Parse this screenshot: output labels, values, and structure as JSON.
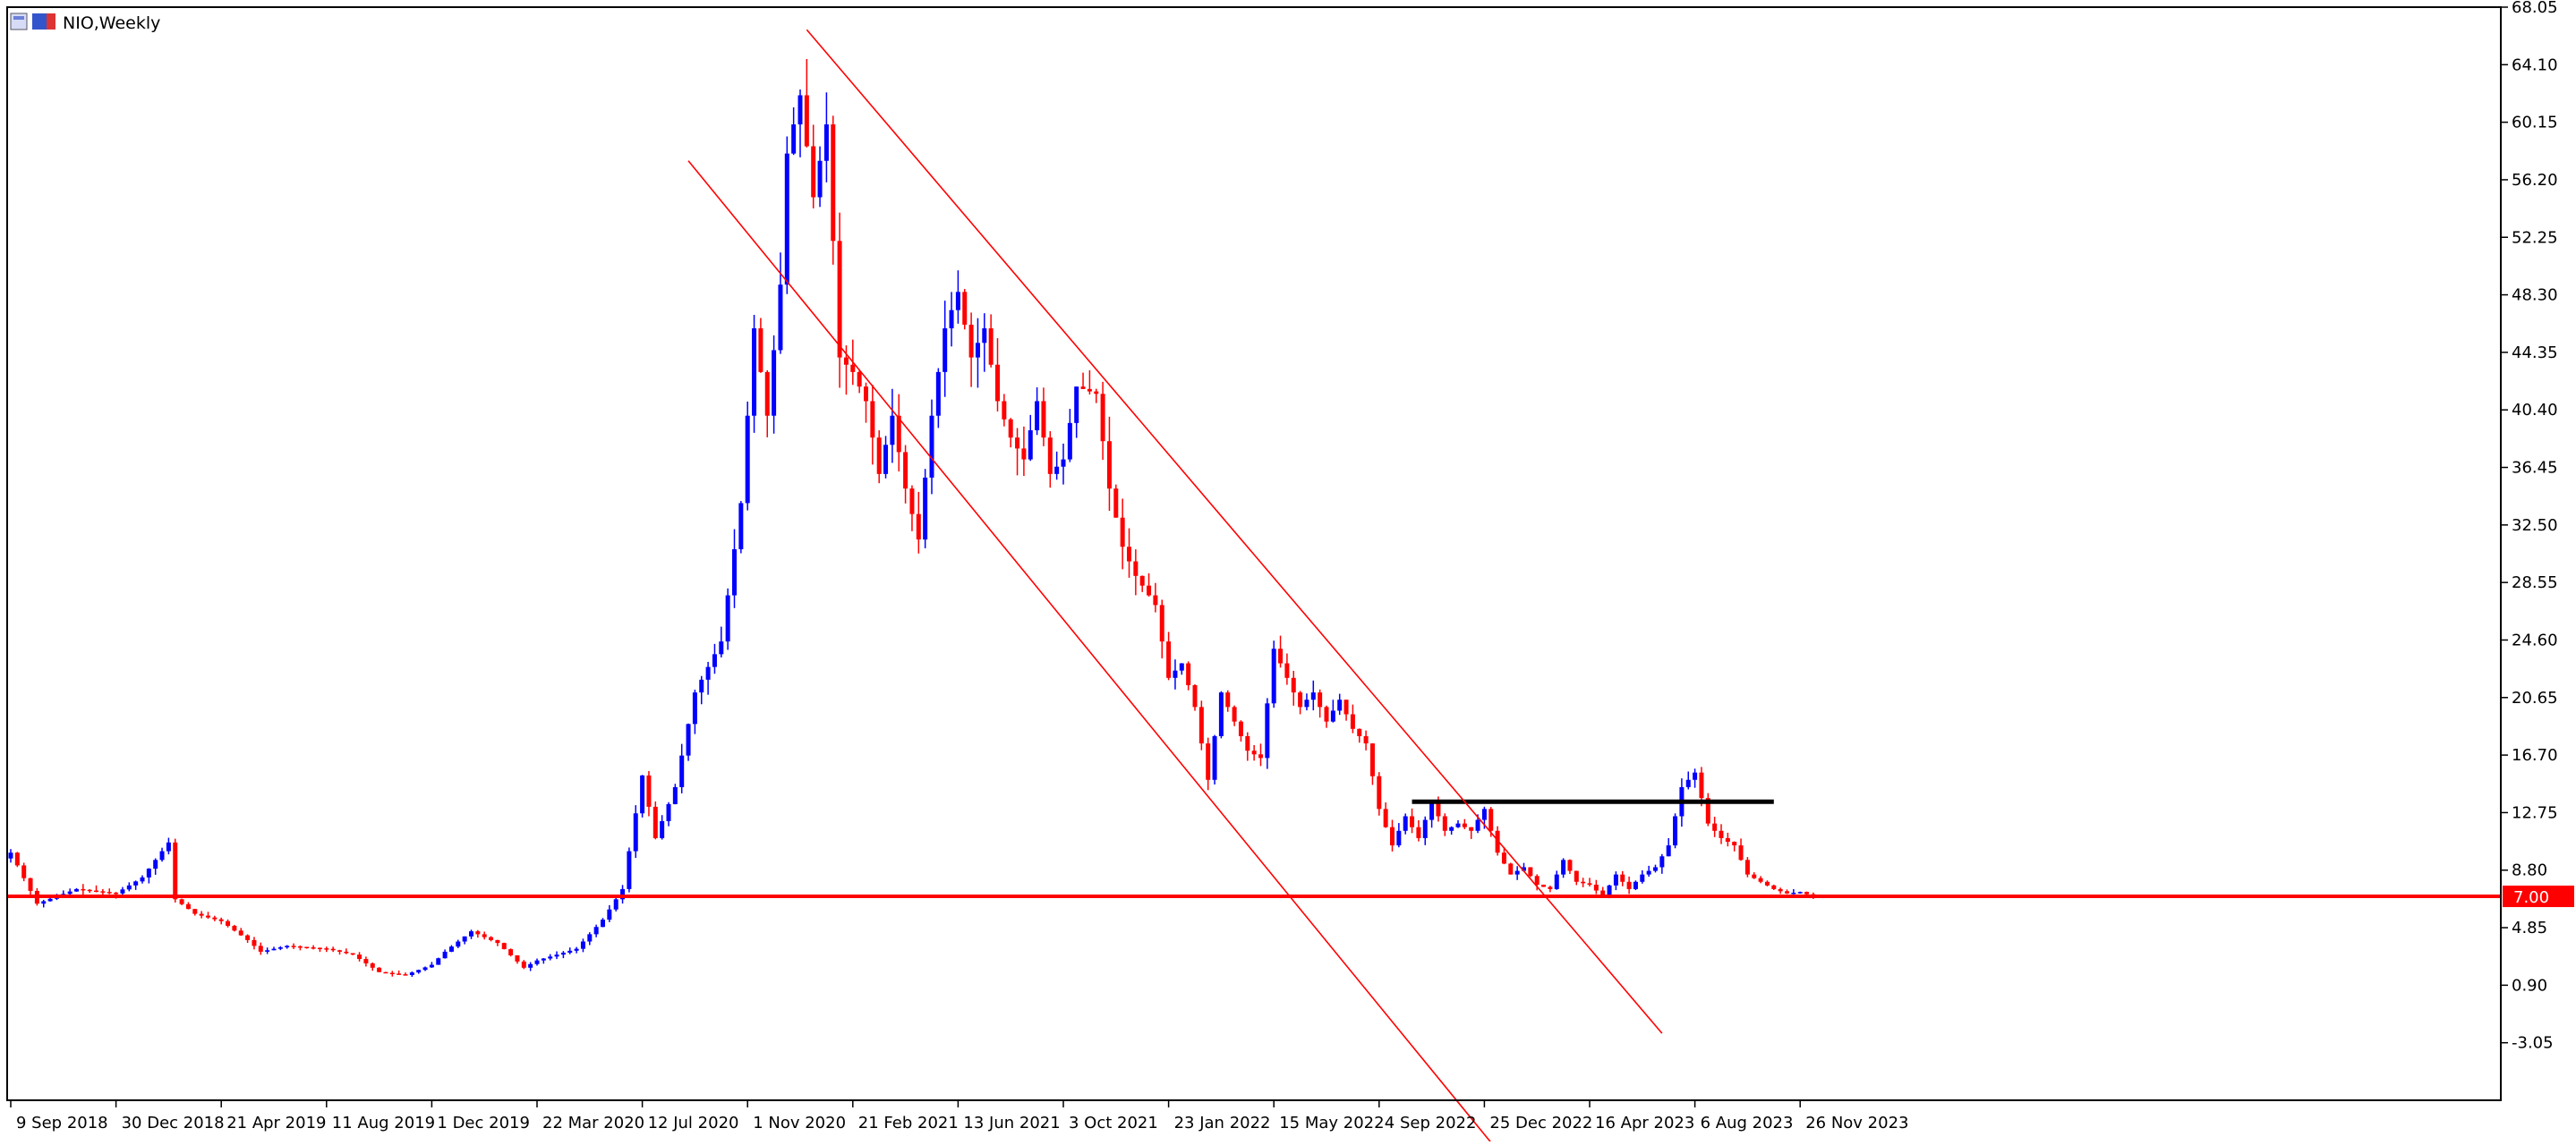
{
  "window": {
    "title": "NIO,Weekly"
  },
  "colors": {
    "background": "#ffffff",
    "frame": "#000000",
    "bull": "#0000ff",
    "bear": "#ff0000",
    "channel": "#ff0000",
    "support": "#ff0000",
    "resistance": "#000000",
    "price_tag_bg": "#ff0000",
    "price_tag_text": "#ffffff"
  },
  "chart_data": {
    "type": "candlestick",
    "symbol": "NIO",
    "timeframe": "Weekly",
    "title": "NIO,Weekly",
    "y_ticks": [
      "68.05",
      "64.10",
      "60.15",
      "56.20",
      "52.25",
      "48.30",
      "44.35",
      "40.40",
      "36.45",
      "32.50",
      "28.55",
      "24.60",
      "20.65",
      "16.70",
      "12.75",
      "8.80",
      "4.85",
      "0.90",
      "-3.05"
    ],
    "ylim": [
      -7.0,
      68.05
    ],
    "x_labels": [
      {
        "label": "9 Sep 2018",
        "week": 0
      },
      {
        "label": "30 Dec 2018",
        "week": 16
      },
      {
        "label": "21 Apr 2019",
        "week": 32
      },
      {
        "label": "11 Aug 2019",
        "week": 48
      },
      {
        "label": "1 Dec 2019",
        "week": 64
      },
      {
        "label": "22 Mar 2020",
        "week": 80
      },
      {
        "label": "12 Jul 2020",
        "week": 96
      },
      {
        "label": "1 Nov 2020",
        "week": 112
      },
      {
        "label": "21 Feb 2021",
        "week": 128
      },
      {
        "label": "13 Jun 2021",
        "week": 144
      },
      {
        "label": "3 Oct 2021",
        "week": 160
      },
      {
        "label": "23 Jan 2022",
        "week": 176
      },
      {
        "label": "15 May 2022",
        "week": 192
      },
      {
        "label": "4 Sep 2022",
        "week": 208
      },
      {
        "label": "25 Dec 2022",
        "week": 224
      },
      {
        "label": "16 Apr 2023",
        "week": 240
      },
      {
        "label": "6 Aug 2023",
        "week": 256
      },
      {
        "label": "26 Nov 2023",
        "week": 272
      }
    ],
    "weeks_total": 290,
    "price_tag": "7.00",
    "horizontal_lines": [
      {
        "name": "support",
        "price": 7.0,
        "from_week": 0,
        "to_week": "end",
        "color": "#ff0000"
      },
      {
        "name": "resistance",
        "price": 13.5,
        "from_week": 213,
        "to_week": 268,
        "color": "#000000"
      }
    ],
    "trend_lines": [
      {
        "name": "channel-upper",
        "from": {
          "week": 121,
          "price": 66.5
        },
        "to": {
          "week": 251,
          "price": -2.4
        }
      },
      {
        "name": "channel-lower",
        "from": {
          "week": 103,
          "price": 57.5
        },
        "to": {
          "week": 227,
          "price": -11.0
        }
      }
    ],
    "close_anchors": [
      [
        0,
        10.0
      ],
      [
        4,
        6.5
      ],
      [
        10,
        7.5
      ],
      [
        16,
        7.2
      ],
      [
        20,
        8.3
      ],
      [
        24,
        10.7
      ],
      [
        25,
        6.8
      ],
      [
        28,
        5.8
      ],
      [
        32,
        5.3
      ],
      [
        36,
        4.0
      ],
      [
        38,
        3.2
      ],
      [
        42,
        3.6
      ],
      [
        48,
        3.4
      ],
      [
        52,
        3.0
      ],
      [
        56,
        1.8
      ],
      [
        60,
        1.6
      ],
      [
        64,
        2.3
      ],
      [
        66,
        3.2
      ],
      [
        70,
        4.6
      ],
      [
        74,
        3.8
      ],
      [
        78,
        2.1
      ],
      [
        80,
        2.6
      ],
      [
        86,
        3.4
      ],
      [
        90,
        5.4
      ],
      [
        93,
        7.5
      ],
      [
        96,
        15.3
      ],
      [
        98,
        11.0
      ],
      [
        101,
        14.5
      ],
      [
        104,
        21.0
      ],
      [
        108,
        24.5
      ],
      [
        111,
        34.0
      ],
      [
        113,
        46.0
      ],
      [
        115,
        40.0
      ],
      [
        117,
        49.0
      ],
      [
        118,
        58.0
      ],
      [
        120,
        62.0
      ],
      [
        122,
        55.0
      ],
      [
        124,
        60.0
      ],
      [
        126,
        44.0
      ],
      [
        128,
        43.0
      ],
      [
        130,
        41.0
      ],
      [
        132,
        36.0
      ],
      [
        134,
        40.0
      ],
      [
        136,
        35.0
      ],
      [
        138,
        31.5
      ],
      [
        140,
        40.0
      ],
      [
        142,
        46.0
      ],
      [
        144,
        48.5
      ],
      [
        146,
        44.0
      ],
      [
        148,
        46.0
      ],
      [
        150,
        41.0
      ],
      [
        152,
        38.5
      ],
      [
        154,
        37.0
      ],
      [
        156,
        41.0
      ],
      [
        158,
        36.0
      ],
      [
        160,
        37.0
      ],
      [
        162,
        42.0
      ],
      [
        165,
        41.5
      ],
      [
        167,
        35.0
      ],
      [
        169,
        31.0
      ],
      [
        171,
        29.0
      ],
      [
        174,
        27.0
      ],
      [
        176,
        22.0
      ],
      [
        178,
        23.0
      ],
      [
        180,
        20.0
      ],
      [
        182,
        15.0
      ],
      [
        184,
        21.0
      ],
      [
        186,
        19.0
      ],
      [
        188,
        17.0
      ],
      [
        190,
        16.5
      ],
      [
        192,
        24.0
      ],
      [
        194,
        22.0
      ],
      [
        196,
        20.0
      ],
      [
        198,
        21.0
      ],
      [
        200,
        19.0
      ],
      [
        202,
        20.5
      ],
      [
        204,
        18.5
      ],
      [
        206,
        17.5
      ],
      [
        208,
        13.0
      ],
      [
        210,
        10.5
      ],
      [
        212,
        12.5
      ],
      [
        214,
        11.0
      ],
      [
        216,
        13.5
      ],
      [
        218,
        11.5
      ],
      [
        220,
        12.0
      ],
      [
        222,
        11.5
      ],
      [
        224,
        13.0
      ],
      [
        226,
        10.0
      ],
      [
        228,
        8.5
      ],
      [
        230,
        9.0
      ],
      [
        232,
        7.8
      ],
      [
        234,
        7.5
      ],
      [
        236,
        9.5
      ],
      [
        238,
        8.0
      ],
      [
        240,
        7.8
      ],
      [
        242,
        7.0
      ],
      [
        244,
        8.5
      ],
      [
        246,
        7.5
      ],
      [
        248,
        8.5
      ],
      [
        250,
        9.0
      ],
      [
        252,
        10.5
      ],
      [
        254,
        14.5
      ],
      [
        256,
        15.5
      ],
      [
        258,
        12.0
      ],
      [
        260,
        11.0
      ],
      [
        262,
        10.5
      ],
      [
        264,
        8.5
      ],
      [
        266,
        8.0
      ],
      [
        268,
        7.5
      ],
      [
        270,
        7.2
      ],
      [
        272,
        7.3
      ],
      [
        274,
        7.0
      ]
    ]
  }
}
